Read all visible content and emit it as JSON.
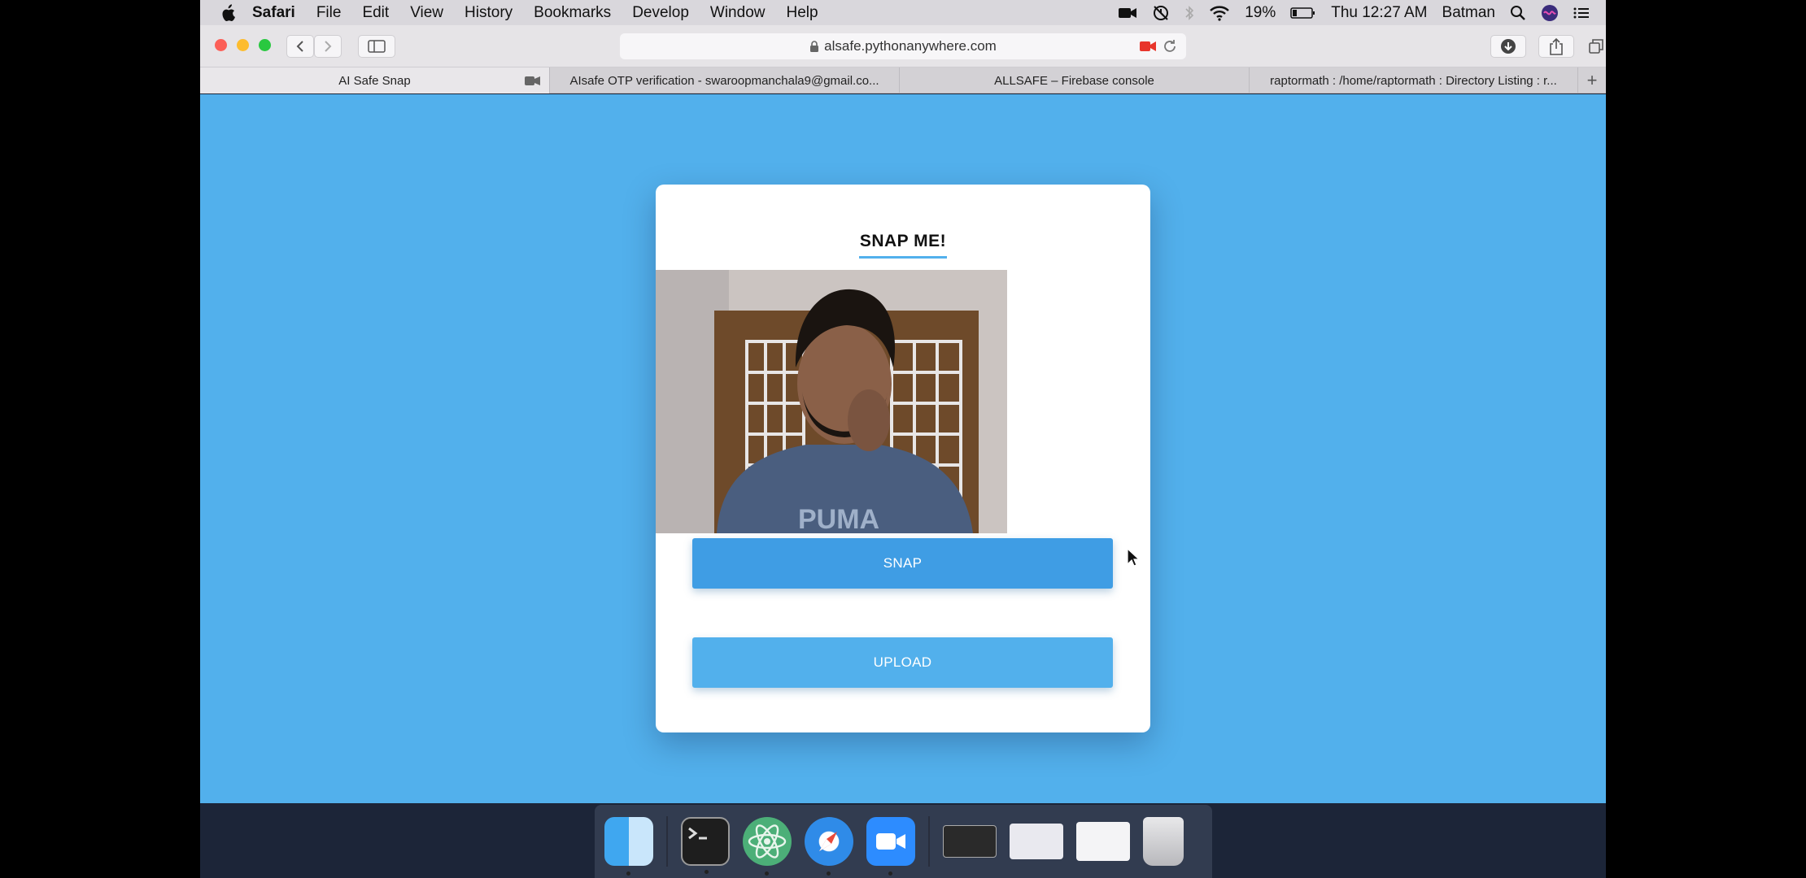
{
  "menubar": {
    "app": "Safari",
    "items": [
      "File",
      "Edit",
      "View",
      "History",
      "Bookmarks",
      "Develop",
      "Window",
      "Help"
    ],
    "battery": "19%",
    "clock": "Thu 12:27 AM",
    "user": "Batman"
  },
  "browser": {
    "url": "alsafe.pythonanywhere.com",
    "tabs": [
      {
        "label": "AI Safe Snap"
      },
      {
        "label": "AIsafe OTP verification - swaroopmanchala9@gmail.co..."
      },
      {
        "label": "ALLSAFE – Firebase console"
      },
      {
        "label": "raptormath : /home/raptormath : Directory Listing : r..."
      }
    ]
  },
  "card": {
    "title": "SNAP ME!",
    "snap_label": "SNAP",
    "upload_label": "UPLOAD"
  },
  "colors": {
    "page_bg": "#52b0ec",
    "snap_btn": "#3f9de4",
    "upload_btn": "#52b0ec"
  },
  "dock": {
    "items": [
      "finder-icon",
      "terminal-icon",
      "atom-icon",
      "safari-icon",
      "zoom-icon",
      "window-thumb-terminal",
      "window-thumb-safari",
      "window-thumb-zoom",
      "trash-icon"
    ]
  }
}
